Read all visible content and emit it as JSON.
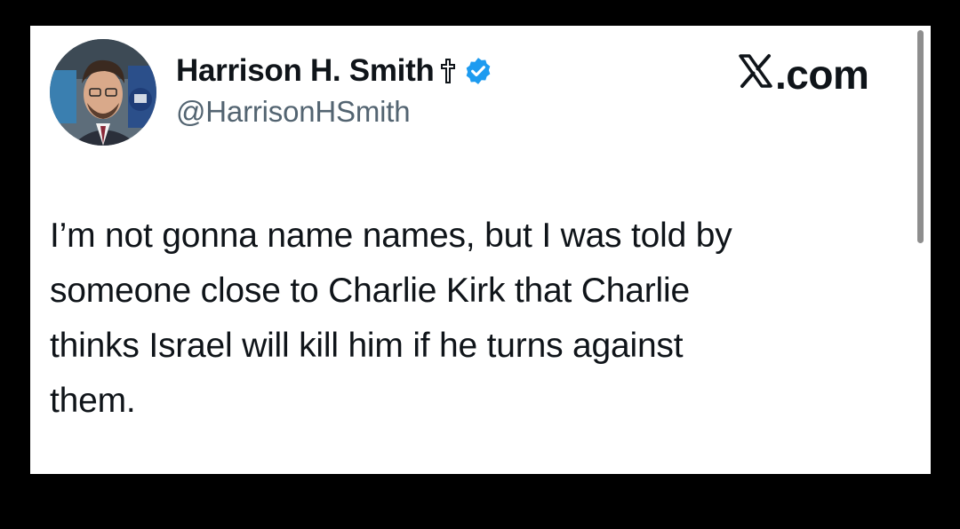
{
  "author": {
    "display_name": "Harrison H. Smith",
    "handle": "@HarrisonHSmith",
    "avatar_icon": "profile-photo",
    "badges": [
      "cross-icon",
      "verified-icon"
    ]
  },
  "site": {
    "label": ".com",
    "logo_icon": "x-logo-icon"
  },
  "tweet": {
    "text": "I’m not gonna name names, but I was told by\nsomeone close to Charlie Kirk that Charlie\nthinks Israel will kill him if he turns against\nthem."
  },
  "colors": {
    "background": "#000000",
    "card": "#ffffff",
    "text_primary": "#0f1419",
    "text_secondary": "#536471",
    "verified_blue": "#1d9bf0"
  }
}
